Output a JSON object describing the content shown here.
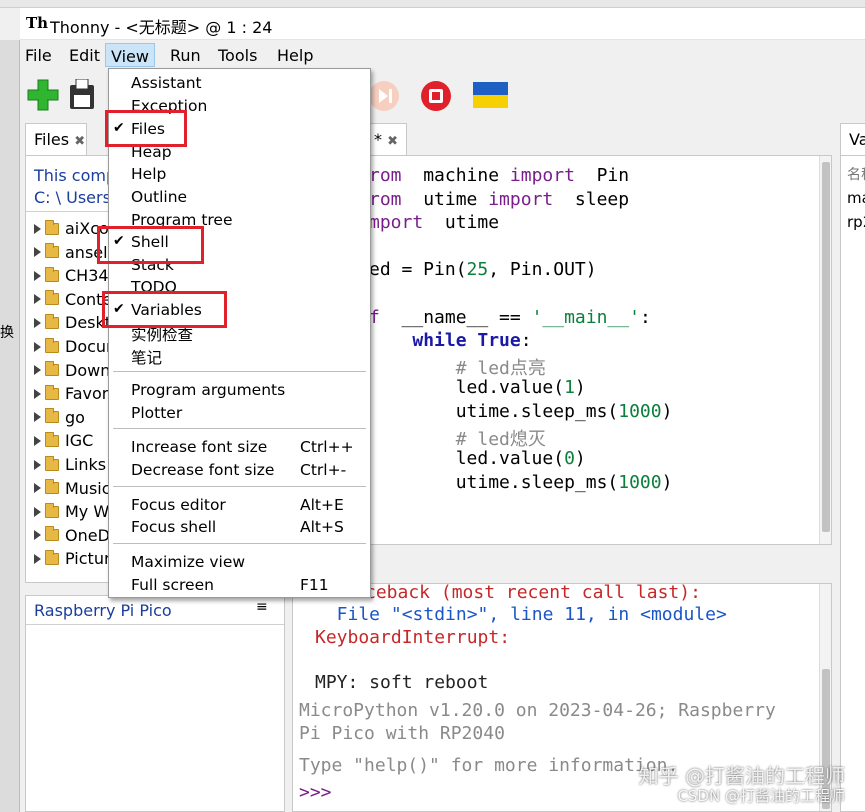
{
  "window": {
    "title": "Thonny  -  <无标题>  @  1 : 24",
    "app_icon": "Th"
  },
  "left_edge_text": "换",
  "menubar": [
    "File",
    "Edit",
    "View",
    "Run",
    "Tools",
    "Help"
  ],
  "files_pane": {
    "tab_label": "Files",
    "location_line1": "This comp",
    "location_line2": "C: \\ Users",
    "items": [
      "aiXco",
      "ansel",
      "CH34",
      "Conte",
      "Deskt",
      "Docur",
      "Down",
      "Favor",
      "go",
      "IGC",
      "Links",
      "Music",
      "My W",
      "OneD",
      "Pictur"
    ],
    "device_label": "Raspberry Pi Pico",
    "menu_icon": "≡"
  },
  "editor": {
    "tab_label": "*",
    "code": [
      {
        "parts": [
          [
            "kw",
            "rom"
          ],
          [
            "",
            "  machine "
          ],
          [
            "kw",
            "import"
          ],
          [
            "",
            "  Pin"
          ]
        ]
      },
      {
        "parts": [
          [
            "kw",
            "rom"
          ],
          [
            "",
            "  utime "
          ],
          [
            "kw",
            "import"
          ],
          [
            "",
            "  sleep"
          ]
        ]
      },
      {
        "parts": [
          [
            "kw",
            "mport"
          ],
          [
            "",
            "  utime"
          ]
        ]
      },
      {
        "parts": [
          [
            "",
            ""
          ]
        ]
      },
      {
        "parts": [
          [
            "",
            "ed = Pin("
          ],
          [
            "num",
            "25"
          ],
          [
            "",
            ", Pin.OUT)"
          ]
        ]
      },
      {
        "parts": [
          [
            "",
            ""
          ]
        ]
      },
      {
        "parts": [
          [
            "kw",
            "f"
          ],
          [
            "",
            "  __name__ == "
          ],
          [
            "str",
            "'__main__'"
          ],
          [
            "",
            ":"
          ]
        ]
      },
      {
        "parts": [
          [
            "",
            "    "
          ],
          [
            "kwb",
            "while True"
          ],
          [
            "",
            ":"
          ]
        ]
      },
      {
        "parts": [
          [
            "",
            "        "
          ],
          [
            "cm",
            "# led点亮"
          ]
        ]
      },
      {
        "parts": [
          [
            "",
            "        led.value("
          ],
          [
            "num",
            "1"
          ],
          [
            "",
            ")"
          ]
        ]
      },
      {
        "parts": [
          [
            "",
            "        utime.sleep_ms("
          ],
          [
            "num",
            "1000"
          ],
          [
            "",
            ")"
          ]
        ]
      },
      {
        "parts": [
          [
            "",
            "        "
          ],
          [
            "cm",
            "# led熄灭"
          ]
        ]
      },
      {
        "parts": [
          [
            "",
            "        led.value("
          ],
          [
            "num",
            "0"
          ],
          [
            "",
            ")"
          ]
        ]
      },
      {
        "parts": [
          [
            "",
            "        utime.sleep_ms("
          ],
          [
            "num",
            "1000"
          ],
          [
            "",
            ")"
          ]
        ]
      }
    ]
  },
  "shell": {
    "lines": [
      {
        "text": "ceback (most recent call last):",
        "color": "#c62828"
      },
      {
        "text": "  File \"<stdin>\", line 11, in <module>",
        "color": "#1a56c8"
      },
      {
        "text": "KeyboardInterrupt:",
        "color": "#c62828"
      },
      {
        "text": "",
        "color": "#000"
      },
      {
        "text": "MPY: soft reboot",
        "color": "#222"
      },
      {
        "text": "MicroPython v1.20.0 on 2023-04-26; Raspberry",
        "color": "#8a8a8a"
      },
      {
        "text": "Pi Pico with RP2040",
        "color": "#8a8a8a"
      },
      {
        "text": "",
        "color": "#000"
      },
      {
        "text": "Type \"help()\" for more information.",
        "color": "#8a8a8a"
      },
      {
        "text": ">>>",
        "color": "#7a1d8c"
      }
    ]
  },
  "variables_pane": {
    "tab_label": "Va",
    "header": "名称",
    "rows": [
      "ma",
      "rp2"
    ]
  },
  "view_menu": {
    "items": [
      {
        "label": "Assistant",
        "checked": false,
        "shortcut": ""
      },
      {
        "label": "Exception",
        "checked": false,
        "shortcut": ""
      },
      {
        "label": "Files",
        "checked": true,
        "shortcut": ""
      },
      {
        "label": "Heap",
        "checked": false,
        "shortcut": ""
      },
      {
        "label": "Help",
        "checked": false,
        "shortcut": ""
      },
      {
        "label": "Outline",
        "checked": false,
        "shortcut": ""
      },
      {
        "label": "Program tree",
        "checked": false,
        "shortcut": ""
      },
      {
        "label": "Shell",
        "checked": true,
        "shortcut": ""
      },
      {
        "label": "Stack",
        "checked": false,
        "shortcut": ""
      },
      {
        "label": "TODO",
        "checked": false,
        "shortcut": ""
      },
      {
        "label": "Variables",
        "checked": true,
        "shortcut": ""
      },
      {
        "label": "实例检查",
        "checked": false,
        "shortcut": ""
      },
      {
        "label": "笔记",
        "checked": false,
        "shortcut": ""
      },
      {
        "label": "Program arguments",
        "checked": false,
        "shortcut": ""
      },
      {
        "label": "Plotter",
        "checked": false,
        "shortcut": ""
      },
      {
        "label": "Increase font size",
        "checked": false,
        "shortcut": "Ctrl++"
      },
      {
        "label": "Decrease font size",
        "checked": false,
        "shortcut": "Ctrl+-"
      },
      {
        "label": "Focus editor",
        "checked": false,
        "shortcut": "Alt+E"
      },
      {
        "label": "Focus shell",
        "checked": false,
        "shortcut": "Alt+S"
      },
      {
        "label": "Maximize view",
        "checked": false,
        "shortcut": ""
      },
      {
        "label": "Full screen",
        "checked": false,
        "shortcut": "F11"
      }
    ],
    "check_glyph": "✔"
  },
  "watermark": {
    "line1": "知乎 @打酱油的工程师",
    "line2": "CSDN @打酱油的工程师"
  },
  "colors": {
    "highlight_box": "#e0202a",
    "new_button": "#2fb52f",
    "stop_button": "#e0202a"
  }
}
